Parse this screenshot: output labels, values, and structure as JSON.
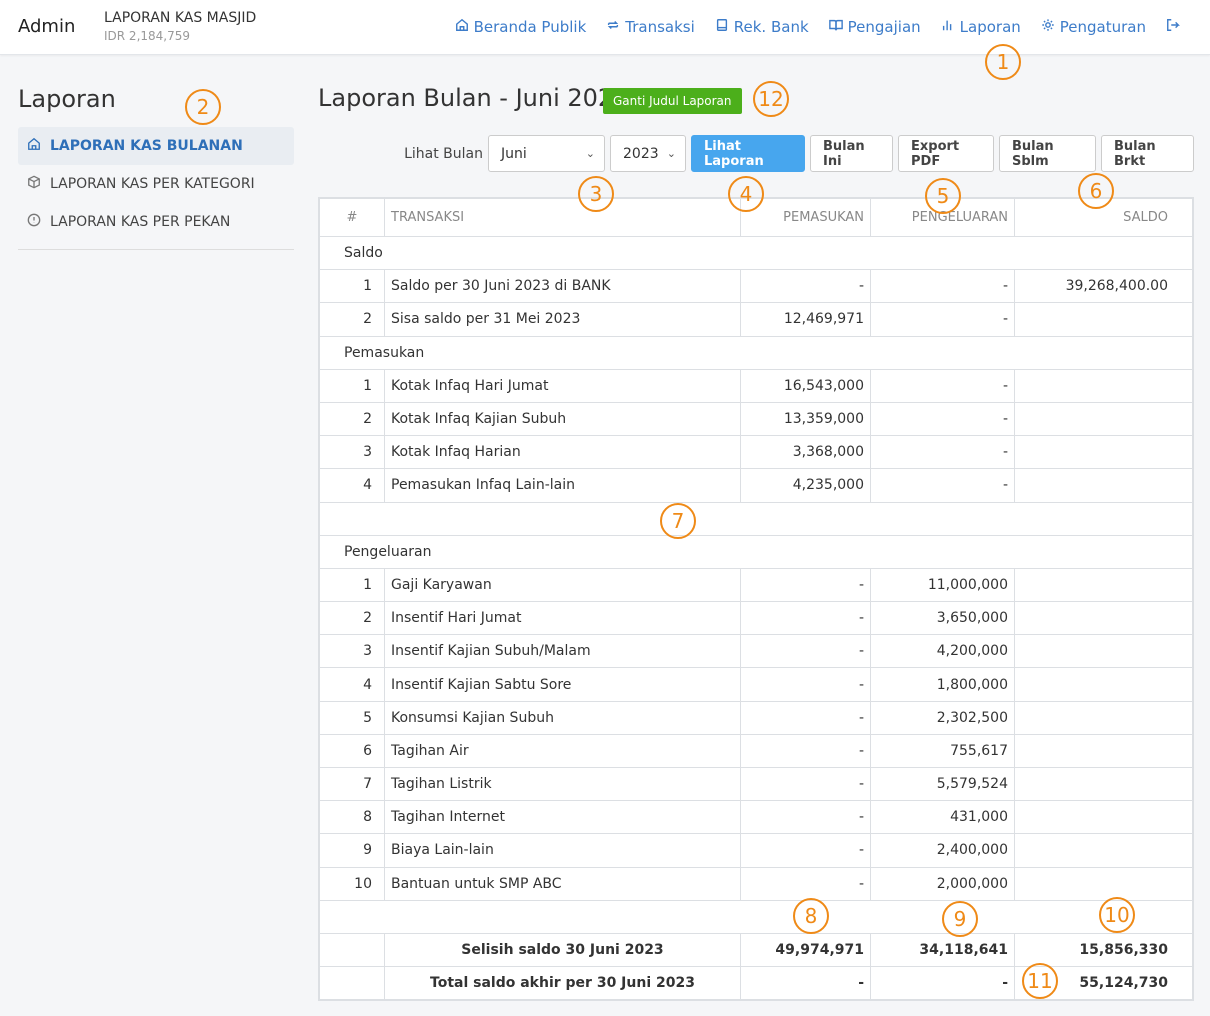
{
  "header": {
    "brand": "Admin",
    "app_name": "LAPORAN KAS MASJID",
    "balance": "IDR 2,184,759",
    "nav": [
      {
        "label": "Beranda Publik",
        "icon": "home-icon"
      },
      {
        "label": "Transaksi",
        "icon": "repeat-icon"
      },
      {
        "label": "Rek. Bank",
        "icon": "book-icon"
      },
      {
        "label": "Pengajian",
        "icon": "open-book-icon"
      },
      {
        "label": "Laporan",
        "icon": "bar-chart-icon"
      },
      {
        "label": "Pengaturan",
        "icon": "gear-icon"
      },
      {
        "label": "",
        "icon": "logout-icon"
      }
    ]
  },
  "sidebar": {
    "title": "Laporan",
    "items": [
      {
        "label": "LAPORAN KAS BULANAN",
        "icon": "home-icon",
        "active": true
      },
      {
        "label": "LAPORAN KAS PER KATEGORI",
        "icon": "box-icon",
        "active": false
      },
      {
        "label": "LAPORAN KAS PER PEKAN",
        "icon": "alert-circle-icon",
        "active": false
      }
    ]
  },
  "main": {
    "title": "Laporan Bulan - Juni 2023",
    "rename_button": "Ganti Judul Laporan",
    "filters": {
      "label": "Lihat Bulan",
      "month": "Juni",
      "year": "2023",
      "view_button": "Lihat Laporan",
      "this_month_button": "Bulan Ini",
      "export_button": "Export PDF",
      "prev_button": "Bulan Sblm",
      "next_button": "Bulan Brkt"
    },
    "table": {
      "headers": {
        "no": "#",
        "tx": "TRANSAKSI",
        "in": "PEMASUKAN",
        "out": "PENGELUARAN",
        "saldo": "SALDO"
      },
      "saldo_title": "Saldo",
      "saldo_rows": [
        {
          "no": "1",
          "tx": "Saldo per 30 Juni 2023 di BANK",
          "in": "-",
          "out": "-",
          "saldo": "39,268,400.00"
        },
        {
          "no": "2",
          "tx": "Sisa saldo per 31 Mei 2023",
          "in": "12,469,971",
          "out": "-",
          "saldo": ""
        }
      ],
      "income_title": "Pemasukan",
      "income_rows": [
        {
          "no": "1",
          "tx": "Kotak Infaq Hari Jumat",
          "in": "16,543,000",
          "out": "-",
          "saldo": ""
        },
        {
          "no": "2",
          "tx": "Kotak Infaq Kajian Subuh",
          "in": "13,359,000",
          "out": "-",
          "saldo": ""
        },
        {
          "no": "3",
          "tx": "Kotak Infaq Harian",
          "in": "3,368,000",
          "out": "-",
          "saldo": ""
        },
        {
          "no": "4",
          "tx": "Pemasukan Infaq Lain-lain",
          "in": "4,235,000",
          "out": "-",
          "saldo": ""
        }
      ],
      "expense_title": "Pengeluaran",
      "expense_rows": [
        {
          "no": "1",
          "tx": "Gaji Karyawan",
          "in": "-",
          "out": "11,000,000",
          "saldo": ""
        },
        {
          "no": "2",
          "tx": "Insentif Hari Jumat",
          "in": "-",
          "out": "3,650,000",
          "saldo": ""
        },
        {
          "no": "3",
          "tx": "Insentif Kajian Subuh/Malam",
          "in": "-",
          "out": "4,200,000",
          "saldo": ""
        },
        {
          "no": "4",
          "tx": "Insentif Kajian Sabtu Sore",
          "in": "-",
          "out": "1,800,000",
          "saldo": ""
        },
        {
          "no": "5",
          "tx": "Konsumsi Kajian Subuh",
          "in": "-",
          "out": "2,302,500",
          "saldo": ""
        },
        {
          "no": "6",
          "tx": "Tagihan Air",
          "in": "-",
          "out": "755,617",
          "saldo": ""
        },
        {
          "no": "7",
          "tx": "Tagihan Listrik",
          "in": "-",
          "out": "5,579,524",
          "saldo": ""
        },
        {
          "no": "8",
          "tx": "Tagihan Internet",
          "in": "-",
          "out": "431,000",
          "saldo": ""
        },
        {
          "no": "9",
          "tx": "Biaya Lain-lain",
          "in": "-",
          "out": "2,400,000",
          "saldo": ""
        },
        {
          "no": "10",
          "tx": "Bantuan untuk SMP ABC",
          "in": "-",
          "out": "2,000,000",
          "saldo": ""
        }
      ],
      "diff_row": {
        "label": "Selisih saldo 30 Juni 2023",
        "in": "49,974,971",
        "out": "34,118,641",
        "saldo": "15,856,330"
      },
      "total_row": {
        "label": "Total saldo akhir per 30 Juni 2023",
        "in": "-",
        "out": "-",
        "saldo": "55,124,730"
      }
    }
  },
  "markers": [
    "1",
    "2",
    "3",
    "4",
    "5",
    "6",
    "7",
    "8",
    "9",
    "10",
    "11",
    "12"
  ],
  "colors": {
    "link": "#3d7cc9",
    "primary_button": "#47a6ee",
    "rename_button": "#4caf1b",
    "marker": "#ef8a17"
  }
}
